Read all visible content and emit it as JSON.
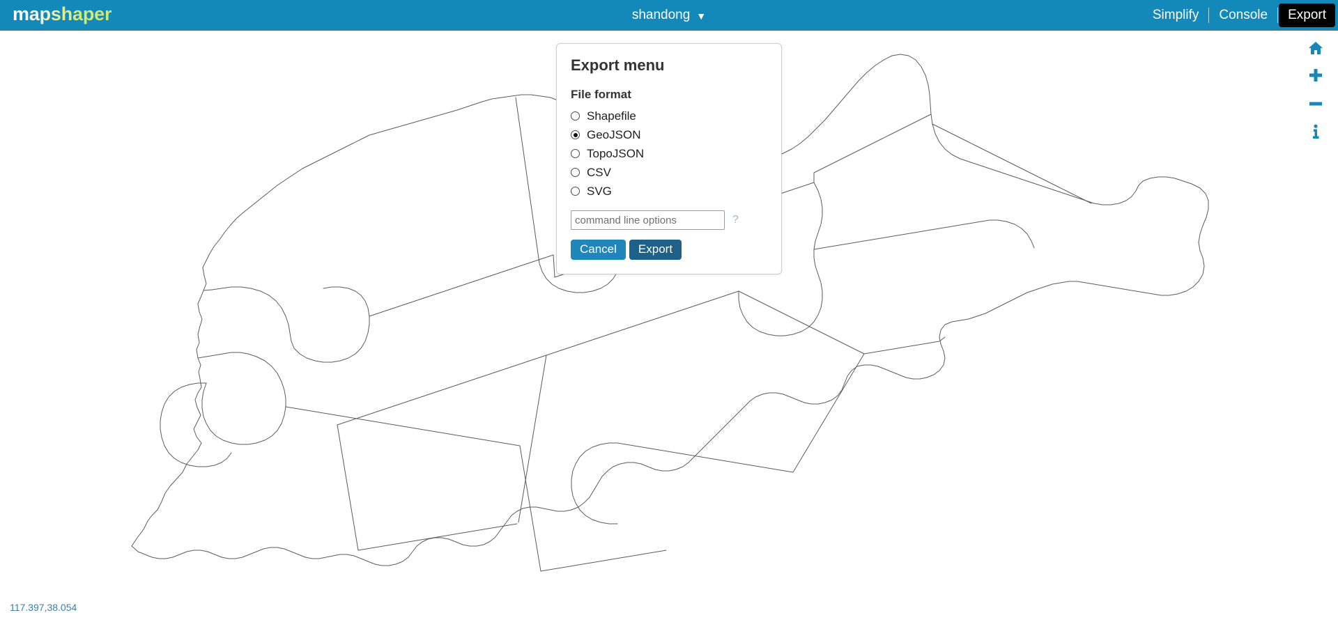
{
  "app": {
    "logo": "mapshaper",
    "accent_color": "#1389b9",
    "active_menu_bg": "#000000"
  },
  "header": {
    "file_title": "shandong",
    "file_title_caret": "▼",
    "menu_items": [
      {
        "label": "Simplify",
        "active": false
      },
      {
        "label": "Console",
        "active": false
      },
      {
        "label": "Export",
        "active": true
      }
    ]
  },
  "map_tools": [
    {
      "name": "home-icon",
      "title": "Zoom to full extent"
    },
    {
      "name": "zoom-in-icon",
      "title": "Zoom in"
    },
    {
      "name": "zoom-out-icon",
      "title": "Zoom out"
    },
    {
      "name": "info-icon",
      "title": "Inspect features"
    }
  ],
  "status": {
    "coordinates": "117.397,38.054"
  },
  "export_menu": {
    "title": "Export menu",
    "file_format_label": "File format",
    "formats": [
      {
        "label": "Shapefile",
        "selected": false
      },
      {
        "label": "GeoJSON",
        "selected": true
      },
      {
        "label": "TopoJSON",
        "selected": false
      },
      {
        "label": "CSV",
        "selected": false
      },
      {
        "label": "SVG",
        "selected": false
      }
    ],
    "command_line_input": {
      "value": "",
      "placeholder": "command line options"
    },
    "help_label": "?",
    "buttons": {
      "cancel": "Cancel",
      "export": "Export"
    },
    "cancel_color": "#1e86ba",
    "export_color": "#1d6188"
  }
}
